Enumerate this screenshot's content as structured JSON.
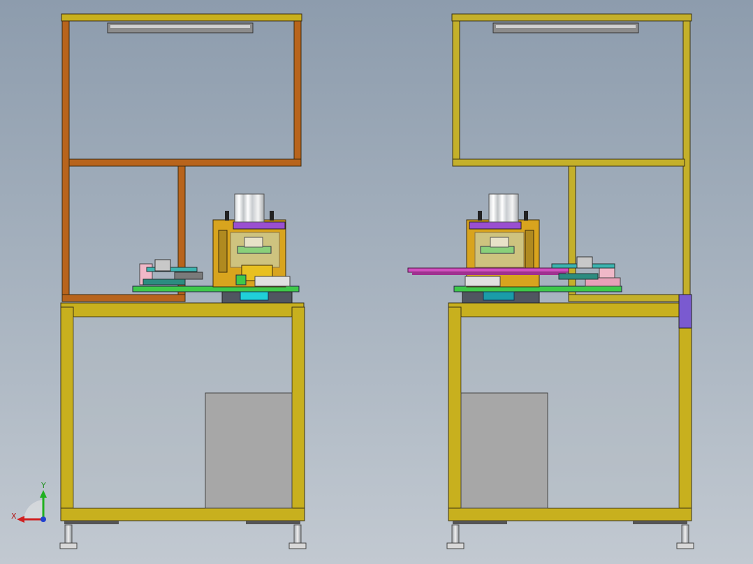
{
  "viewport": {
    "triad": {
      "x_label": "X",
      "y_label": "Y"
    }
  },
  "colors": {
    "upper_frame_left": "#b8641c",
    "upper_frame_right": "#c4b02a",
    "lower_frame": "#c8b01e",
    "frame_edge": "#3a3214",
    "cabinet_panel": "#a7a7a7",
    "cylinder": "#e6e6e6",
    "press_body": "#d8a41e",
    "press_plate": "#9a4fd0",
    "slide_pink": "#d24fc0",
    "cyan_block": "#20d0d8",
    "green_plate": "#3ec84a",
    "bracket_purple": "#7a5ad0",
    "axis_x": "#d02020",
    "axis_y": "#20b020",
    "axis_z": "#2040d0"
  }
}
